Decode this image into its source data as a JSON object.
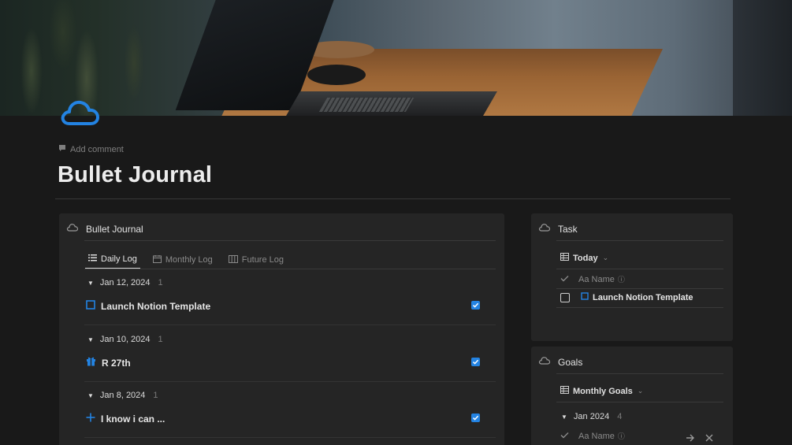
{
  "page": {
    "title": "Bullet Journal",
    "add_comment": "Add comment",
    "icon": "cloud-icon",
    "accent_color": "#2383e2"
  },
  "bullet_journal": {
    "heading": "Bullet Journal",
    "tabs": [
      {
        "label": "Daily Log",
        "icon": "list-icon",
        "active": true
      },
      {
        "label": "Monthly Log",
        "icon": "calendar-icon",
        "active": false
      },
      {
        "label": "Future Log",
        "icon": "board-icon",
        "active": false
      }
    ],
    "groups": [
      {
        "date": "Jan 12, 2024",
        "count": "1",
        "item": {
          "label": "Launch Notion Template",
          "icon": "square-icon",
          "checked": true
        }
      },
      {
        "date": "Jan 10, 2024",
        "count": "1",
        "item": {
          "label": "R 27th",
          "icon": "gift-icon",
          "checked": true
        }
      },
      {
        "date": "Jan 8, 2024",
        "count": "1",
        "item": {
          "label": "I know i can ...",
          "icon": "plus-icon",
          "checked": true
        }
      }
    ]
  },
  "task": {
    "heading": "Task",
    "view": "Today",
    "property_header": "Aa Name",
    "rows": [
      {
        "label": "Launch Notion Template",
        "checked": false
      }
    ]
  },
  "goals": {
    "heading": "Goals",
    "view": "Monthly Goals",
    "group": {
      "date": "Jan 2024",
      "count": "4"
    },
    "property_header": "Aa Name"
  }
}
